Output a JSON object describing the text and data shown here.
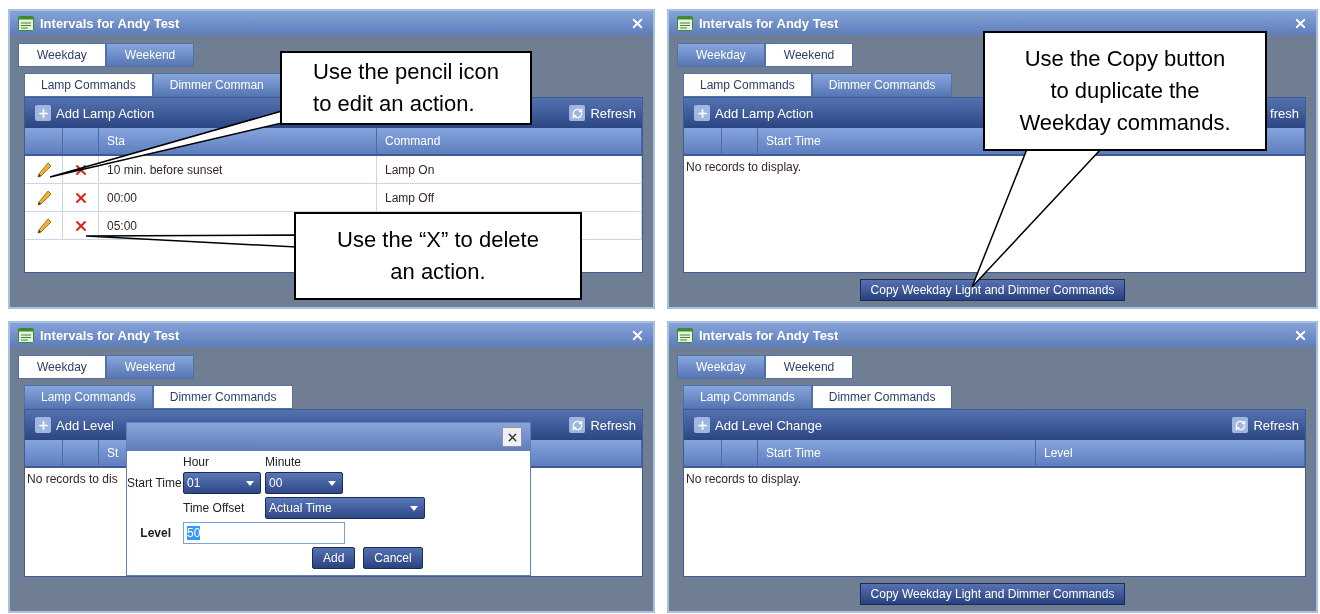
{
  "panels": [
    {
      "title": "Intervals for Andy Test",
      "day_tabs": [
        {
          "label": "Weekday",
          "selected": true
        },
        {
          "label": "Weekend",
          "selected": false
        }
      ],
      "command_tabs": [
        {
          "label": "Lamp Commands",
          "selected": true
        },
        {
          "label": "Dimmer Comman",
          "selected": false
        }
      ],
      "toolbar": {
        "add_label": "Add Lamp Action",
        "refresh_label": "Refresh",
        "refresh_icon": true
      },
      "columns": [
        "Sta",
        "Command"
      ],
      "rows": [
        {
          "start_time": "10 min. before sunset",
          "command": "Lamp On"
        },
        {
          "start_time": "00:00",
          "command": "Lamp Off"
        },
        {
          "start_time": "05:00"
        }
      ],
      "callouts": [
        {
          "text": "Use the pencil icon\nto edit an action."
        },
        {
          "text": "Use the “X” to delete\nan action."
        }
      ]
    },
    {
      "title": "Intervals for Andy Test",
      "day_tabs": [
        {
          "label": "Weekday",
          "selected": false
        },
        {
          "label": "Weekend",
          "selected": true
        }
      ],
      "command_tabs": [
        {
          "label": "Lamp Commands",
          "selected": true
        },
        {
          "label": "Dimmer Commands",
          "selected": false
        }
      ],
      "toolbar": {
        "add_label": "Add Lamp Action",
        "refresh_label": "fresh",
        "refresh_icon": false
      },
      "columns": [
        "Start Time"
      ],
      "empty_message": "No records to display.",
      "copy_button": "Copy Weekday Light and Dimmer Commands",
      "callouts": [
        {
          "text": "Use the Copy button\nto duplicate the\nWeekday commands."
        }
      ]
    },
    {
      "title": "Intervals for Andy Test",
      "day_tabs": [
        {
          "label": "Weekday",
          "selected": true
        },
        {
          "label": "Weekend",
          "selected": false
        }
      ],
      "command_tabs": [
        {
          "label": "Lamp Commands",
          "selected": false
        },
        {
          "label": "Dimmer Commands",
          "selected": true
        }
      ],
      "toolbar": {
        "add_label": "Add Level",
        "refresh_label": "Refresh",
        "refresh_icon": true
      },
      "columns": [
        "St"
      ],
      "empty_message": "No records to dis",
      "dialog": {
        "hour_label": "Hour",
        "minute_label": "Minute",
        "start_time_label": "Start Time",
        "hour": "01",
        "minute": "00",
        "offset_label": "Time Offset",
        "offset": "Actual Time",
        "level_label": "Level",
        "level_value": "50",
        "level_text_selected": true,
        "buttons": [
          "Add",
          "Cancel"
        ]
      }
    },
    {
      "title": "Intervals for Andy Test",
      "day_tabs": [
        {
          "label": "Weekday",
          "selected": false
        },
        {
          "label": "Weekend",
          "selected": true
        }
      ],
      "command_tabs": [
        {
          "label": "Lamp Commands",
          "selected": false
        },
        {
          "label": "Dimmer Commands",
          "selected": true
        }
      ],
      "toolbar": {
        "add_label": "Add Level Change",
        "refresh_label": "Refresh",
        "refresh_icon": true
      },
      "columns": [
        "Start Time",
        "Level"
      ],
      "empty_message": "No records to display.",
      "copy_button": "Copy Weekday Light and Dimmer Commands"
    }
  ]
}
